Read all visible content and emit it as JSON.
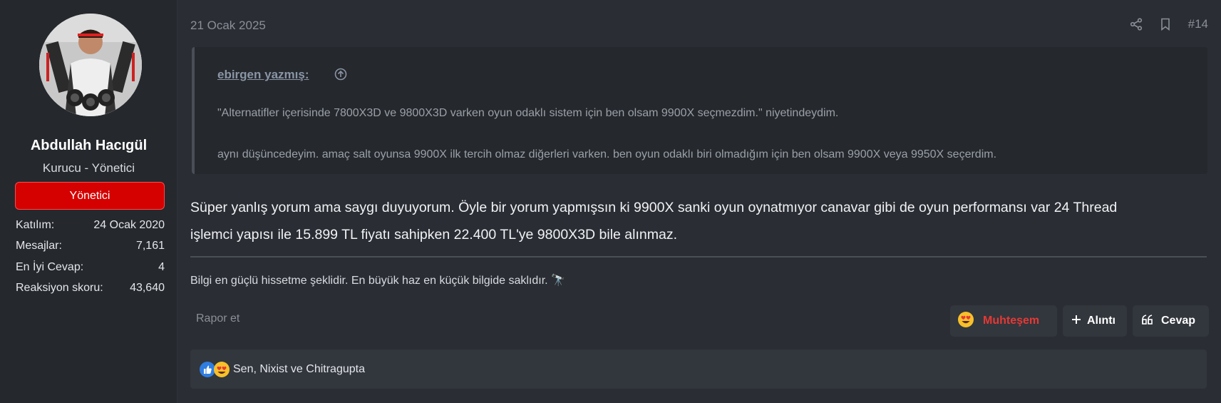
{
  "user": {
    "name": "Abdullah Hacıgül",
    "title": "Kurucu - Yönetici",
    "role_badge": "Yönetici",
    "stats": [
      {
        "label": "Katılım:",
        "value": "24 Ocak 2020"
      },
      {
        "label": "Mesajlar:",
        "value": "7,161"
      },
      {
        "label": "En İyi Cevap:",
        "value": "4"
      },
      {
        "label": "Reaksiyon skoru:",
        "value": "43,640"
      }
    ]
  },
  "post": {
    "date": "21 Ocak 2025",
    "number": "#14",
    "quote": {
      "author": "ebirgen yazmış:",
      "lines": [
        "\"Alternatifler içerisinde 7800X3D ve 9800X3D varken oyun odaklı sistem için ben olsam 9900X seçmezdim.\" niyetindeydim.",
        "aynı düşüncedeyim. amaç salt oyunsa 9900X ilk tercih olmaz diğerleri varken. ben oyun odaklı biri olmadığım için ben olsam 9900X veya 9950X seçerdim."
      ]
    },
    "message_lines": [
      "Süper yanlış yorum ama saygı duyuyorum. Öyle bir yorum yapmışsın ki 9900X sanki oyun oynatmıyor canavar gibi de oyun performansı var 24 Thread",
      "işlemci yapısı ile 15.899 TL fiyatı sahipken 22.400 TL'ye 9800X3D bile alınmaz."
    ],
    "signature": "Bilgi en güçlü hissetme şeklidir. En büyük haz en küçük bilgide saklıdır.",
    "signature_emoji": "🔭"
  },
  "actions": {
    "report": "Rapor et",
    "react": "Muhteşem",
    "quote": "Alıntı",
    "reply": "Cevap"
  },
  "reactions": {
    "text": "Sen, Nixist ve Chitragupta"
  },
  "colors": {
    "badge": "#d50000",
    "react_text": "#e53935",
    "like_blue": "#2f7de1",
    "heart_eyes_yellow": "#f7c02b"
  }
}
